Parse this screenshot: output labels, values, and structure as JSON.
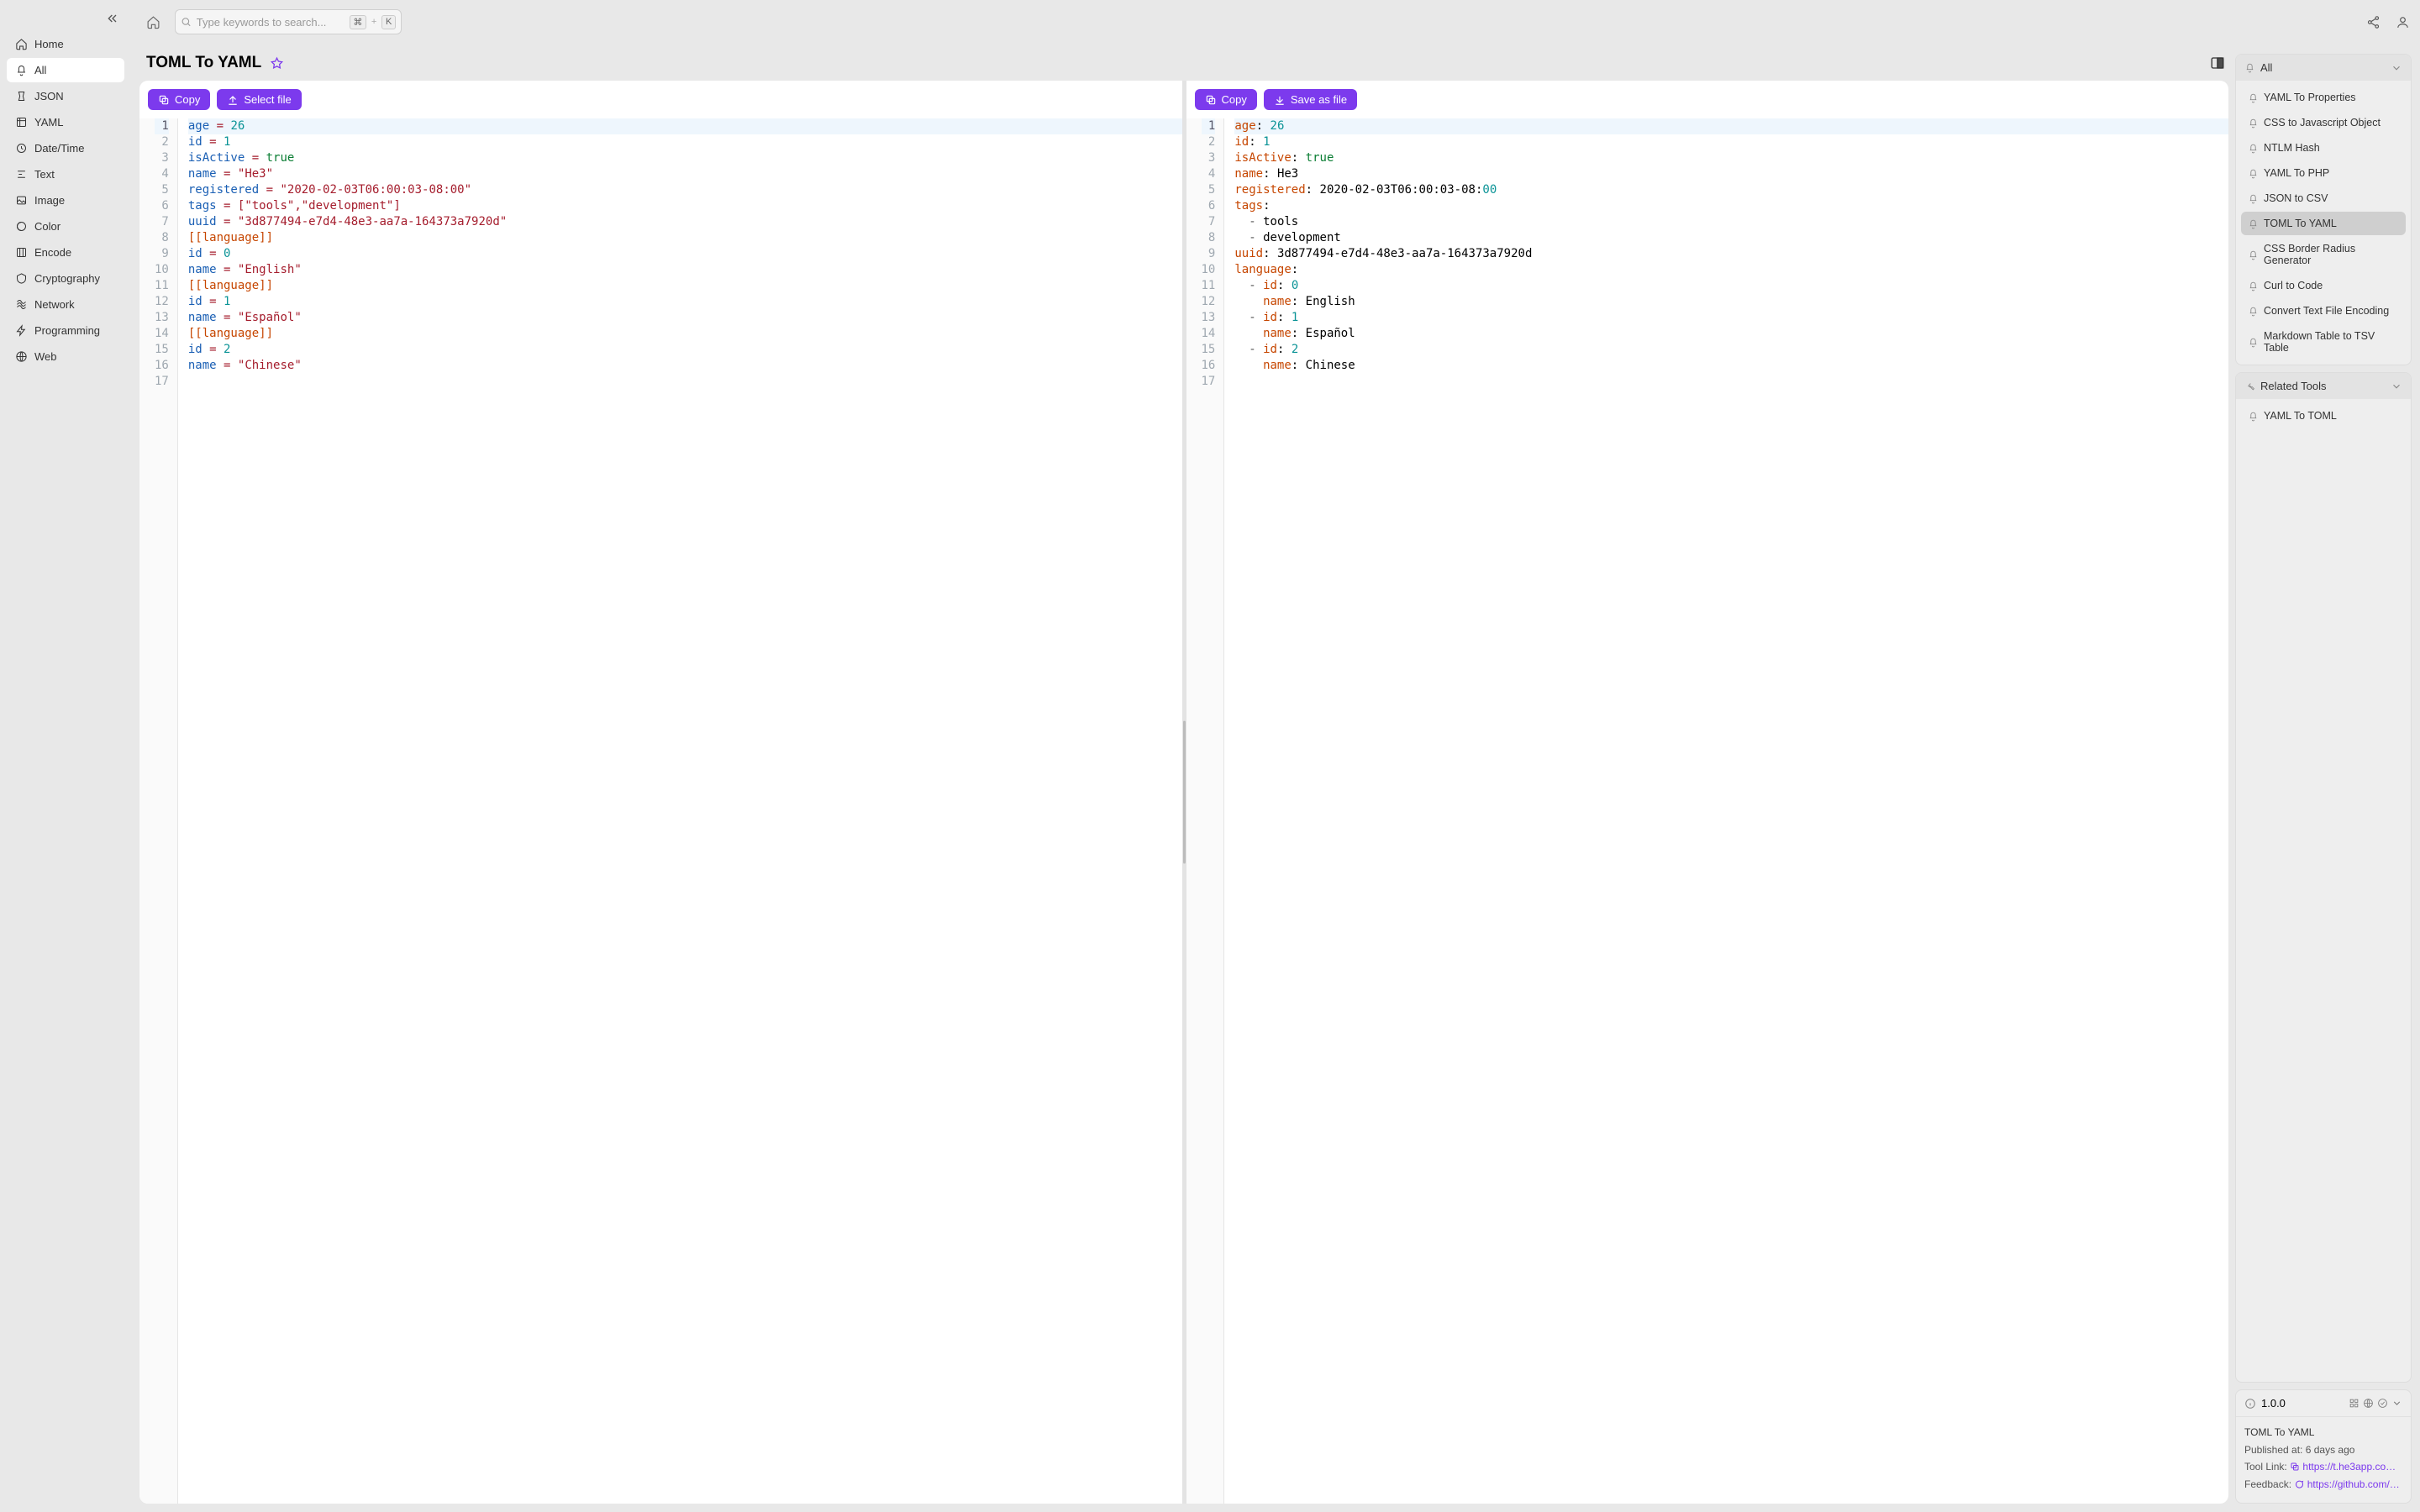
{
  "search": {
    "placeholder": "Type keywords to search...",
    "k1": "⌘",
    "plus": "+",
    "k2": "K"
  },
  "sidebar": {
    "items": [
      {
        "label": "Home"
      },
      {
        "label": "All"
      },
      {
        "label": "JSON"
      },
      {
        "label": "YAML"
      },
      {
        "label": "Date/Time"
      },
      {
        "label": "Text"
      },
      {
        "label": "Image"
      },
      {
        "label": "Color"
      },
      {
        "label": "Encode"
      },
      {
        "label": "Cryptography"
      },
      {
        "label": "Network"
      },
      {
        "label": "Programming"
      },
      {
        "label": "Web"
      }
    ]
  },
  "tool": {
    "title": "TOML To YAML"
  },
  "btn": {
    "copy": "Copy",
    "select_file": "Select file",
    "save_file": "Save as file"
  },
  "left_lines": [
    [
      [
        "age",
        "k"
      ],
      [
        " ",
        "p"
      ],
      [
        "=",
        "e"
      ],
      [
        " ",
        "p"
      ],
      [
        "26",
        "n"
      ]
    ],
    [
      [
        "id",
        "k"
      ],
      [
        " ",
        "p"
      ],
      [
        "=",
        "e"
      ],
      [
        " ",
        "p"
      ],
      [
        "1",
        "n"
      ]
    ],
    [
      [
        "isActive",
        "k"
      ],
      [
        " ",
        "p"
      ],
      [
        "=",
        "e"
      ],
      [
        " ",
        "p"
      ],
      [
        "true",
        "b"
      ]
    ],
    [
      [
        "name",
        "k"
      ],
      [
        " ",
        "p"
      ],
      [
        "=",
        "e"
      ],
      [
        " ",
        "p"
      ],
      [
        "\"He3\"",
        "s"
      ]
    ],
    [
      [
        "registered",
        "k"
      ],
      [
        " ",
        "p"
      ],
      [
        "=",
        "e"
      ],
      [
        " ",
        "p"
      ],
      [
        "\"2020-02-03T06:00:03-08:00\"",
        "s"
      ]
    ],
    [
      [
        "tags",
        "k"
      ],
      [
        " ",
        "p"
      ],
      [
        "=",
        "e"
      ],
      [
        " ",
        "p"
      ],
      [
        "[\"tools\",\"development\"]",
        "s"
      ]
    ],
    [
      [
        "uuid",
        "k"
      ],
      [
        " ",
        "p"
      ],
      [
        "=",
        "e"
      ],
      [
        " ",
        "p"
      ],
      [
        "\"3d877494-e7d4-48e3-aa7a-164373a7920d\"",
        "s"
      ]
    ],
    [
      [
        "[[language]]",
        "sec"
      ]
    ],
    [
      [
        "id",
        "k"
      ],
      [
        " ",
        "p"
      ],
      [
        "=",
        "e"
      ],
      [
        " ",
        "p"
      ],
      [
        "0",
        "n"
      ]
    ],
    [
      [
        "name",
        "k"
      ],
      [
        " ",
        "p"
      ],
      [
        "=",
        "e"
      ],
      [
        " ",
        "p"
      ],
      [
        "\"English\"",
        "s"
      ]
    ],
    [
      [
        "[[language]]",
        "sec"
      ]
    ],
    [
      [
        "id",
        "k"
      ],
      [
        " ",
        "p"
      ],
      [
        "=",
        "e"
      ],
      [
        " ",
        "p"
      ],
      [
        "1",
        "n"
      ]
    ],
    [
      [
        "name",
        "k"
      ],
      [
        " ",
        "p"
      ],
      [
        "=",
        "e"
      ],
      [
        " ",
        "p"
      ],
      [
        "\"Español\"",
        "s"
      ]
    ],
    [
      [
        "[[language]]",
        "sec"
      ]
    ],
    [
      [
        "id",
        "k"
      ],
      [
        " ",
        "p"
      ],
      [
        "=",
        "e"
      ],
      [
        " ",
        "p"
      ],
      [
        "2",
        "n"
      ]
    ],
    [
      [
        "name",
        "k"
      ],
      [
        " ",
        "p"
      ],
      [
        "=",
        "e"
      ],
      [
        " ",
        "p"
      ],
      [
        "\"Chinese\"",
        "s"
      ]
    ],
    []
  ],
  "right_lines": [
    [
      [
        "age",
        "c"
      ],
      [
        ": ",
        "p"
      ],
      [
        "26",
        "n"
      ]
    ],
    [
      [
        "id",
        "c"
      ],
      [
        ": ",
        "p"
      ],
      [
        "1",
        "n"
      ]
    ],
    [
      [
        "isActive",
        "c"
      ],
      [
        ": ",
        "p"
      ],
      [
        "true",
        "b"
      ]
    ],
    [
      [
        "name",
        "c"
      ],
      [
        ": ",
        "p"
      ],
      [
        "He3",
        "p"
      ]
    ],
    [
      [
        "registered",
        "c"
      ],
      [
        ": ",
        "p"
      ],
      [
        "2020-02-03T06:00:03-08:",
        "p"
      ],
      [
        "00",
        "n"
      ]
    ],
    [
      [
        "tags",
        "c"
      ],
      [
        ":",
        "p"
      ]
    ],
    [
      [
        "  ",
        "p"
      ],
      [
        "-",
        "d"
      ],
      [
        " tools",
        "p"
      ]
    ],
    [
      [
        "  ",
        "p"
      ],
      [
        "-",
        "d"
      ],
      [
        " development",
        "p"
      ]
    ],
    [
      [
        "uuid",
        "c"
      ],
      [
        ": ",
        "p"
      ],
      [
        "3d877494-e7d4-48e3-aa7a-164373a7920d",
        "p"
      ]
    ],
    [
      [
        "language",
        "c"
      ],
      [
        ":",
        "p"
      ]
    ],
    [
      [
        "  ",
        "p"
      ],
      [
        "-",
        "d"
      ],
      [
        " ",
        "p"
      ],
      [
        "id",
        "c"
      ],
      [
        ": ",
        "p"
      ],
      [
        "0",
        "n"
      ]
    ],
    [
      [
        "    ",
        "p"
      ],
      [
        "name",
        "c"
      ],
      [
        ": ",
        "p"
      ],
      [
        "English",
        "p"
      ]
    ],
    [
      [
        "  ",
        "p"
      ],
      [
        "-",
        "d"
      ],
      [
        " ",
        "p"
      ],
      [
        "id",
        "c"
      ],
      [
        ": ",
        "p"
      ],
      [
        "1",
        "n"
      ]
    ],
    [
      [
        "    ",
        "p"
      ],
      [
        "name",
        "c"
      ],
      [
        ": ",
        "p"
      ],
      [
        "Español",
        "p"
      ]
    ],
    [
      [
        "  ",
        "p"
      ],
      [
        "-",
        "d"
      ],
      [
        " ",
        "p"
      ],
      [
        "id",
        "c"
      ],
      [
        ": ",
        "p"
      ],
      [
        "2",
        "n"
      ]
    ],
    [
      [
        "    ",
        "p"
      ],
      [
        "name",
        "c"
      ],
      [
        ": ",
        "p"
      ],
      [
        "Chinese",
        "p"
      ]
    ],
    []
  ],
  "all_panel": {
    "title": "All",
    "items": [
      "YAML To Properties",
      "CSS to Javascript Object",
      "NTLM Hash",
      "YAML To PHP",
      "JSON to CSV",
      "TOML To YAML",
      "CSS Border Radius Generator",
      "Curl to Code",
      "Convert Text File Encoding",
      "Markdown Table to TSV Table"
    ],
    "active_index": 5
  },
  "related": {
    "title": "Related Tools",
    "items": [
      "YAML To TOML"
    ]
  },
  "info": {
    "version": "1.0.0",
    "name": "TOML To YAML",
    "published_label": "Published at:",
    "published_value": "6 days ago",
    "tool_link_label": "Tool Link:",
    "tool_link_value": "https://t.he3app.co…",
    "feedback_label": "Feedback:",
    "feedback_value": "https://github.com/…"
  }
}
